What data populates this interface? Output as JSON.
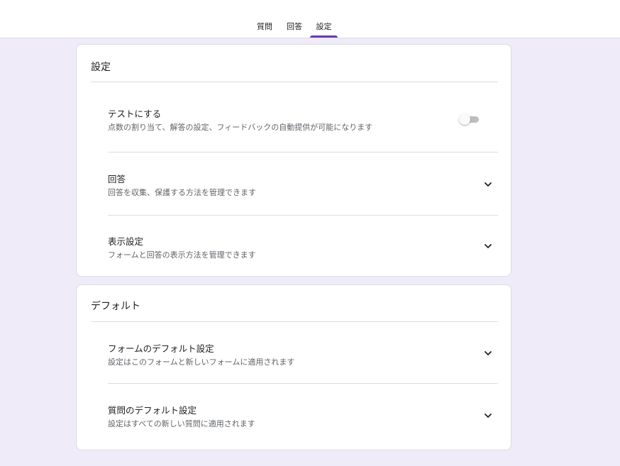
{
  "tabs": [
    {
      "label": "質問",
      "active": false
    },
    {
      "label": "回答",
      "active": false
    },
    {
      "label": "設定",
      "active": true
    }
  ],
  "settings_card": {
    "title": "設定",
    "rows": [
      {
        "title": "テストにする",
        "desc": "点数の割り当て、解答の設定、フィードバックの自動提供が可能になります",
        "control": "toggle",
        "toggle_on": false
      },
      {
        "title": "回答",
        "desc": "回答を収集、保護する方法を管理できます",
        "control": "chevron-down-icon"
      },
      {
        "title": "表示設定",
        "desc": "フォームと回答の表示方法を管理できます",
        "control": "chevron-down-icon"
      }
    ]
  },
  "defaults_card": {
    "title": "デフォルト",
    "rows": [
      {
        "title": "フォームのデフォルト設定",
        "desc": "設定はこのフォームと新しいフォームに適用されます",
        "control": "chevron-down-icon"
      },
      {
        "title": "質問のデフォルト設定",
        "desc": "設定はすべての新しい質問に適用されます",
        "control": "chevron-down-icon"
      }
    ]
  },
  "colors": {
    "accent": "#673ab7",
    "background": "#f0ebf8",
    "card": "#ffffff",
    "divider": "#dadce0",
    "text_primary": "#202124",
    "text_secondary": "#5f6368"
  }
}
